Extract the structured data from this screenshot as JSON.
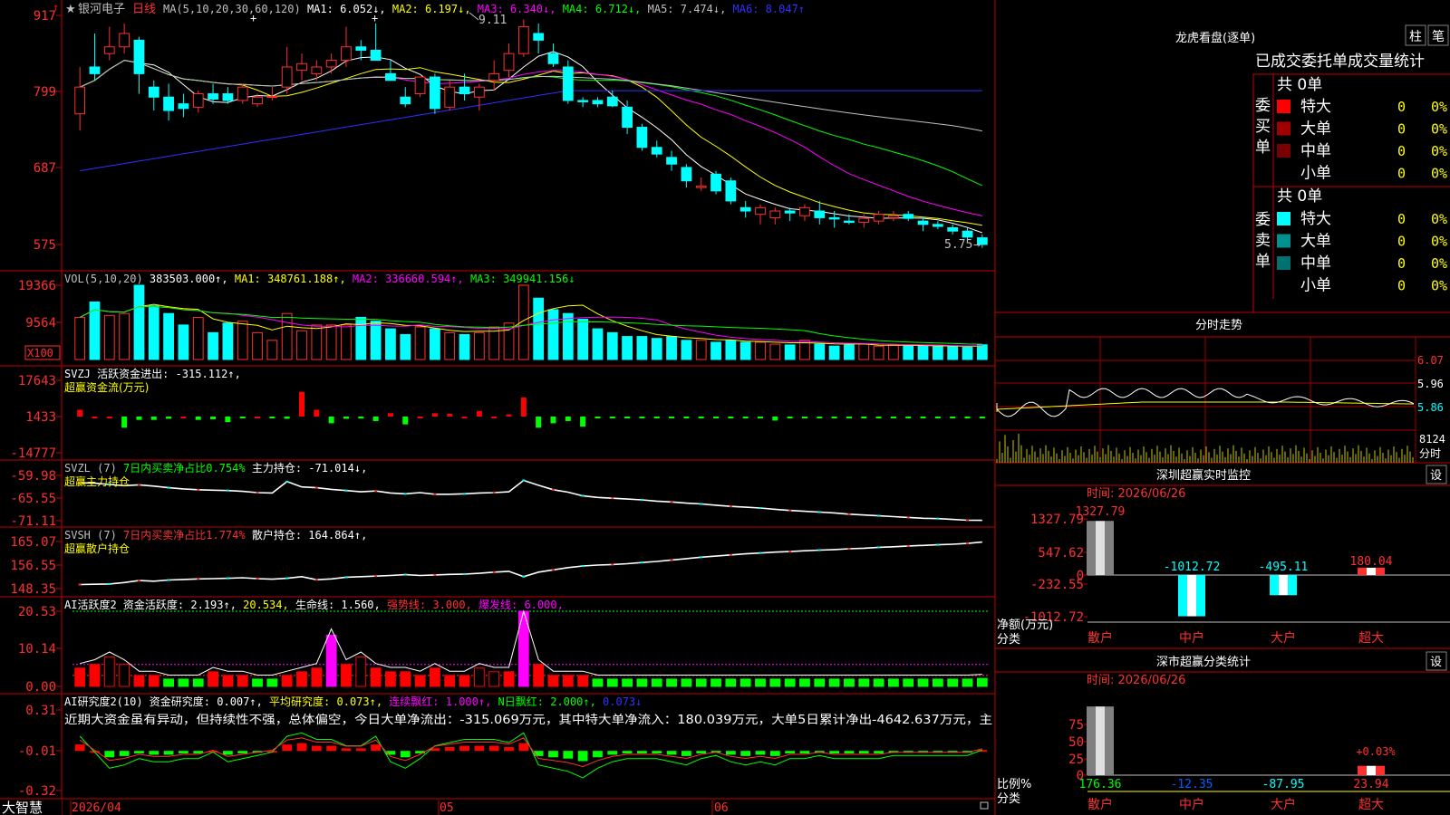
{
  "app": {
    "brand": "大智慧"
  },
  "stock": {
    "star": "★",
    "name": "银河电子",
    "period": "日线"
  },
  "kline": {
    "y_ticks": [
      "917",
      "799",
      "687",
      "575"
    ],
    "high_label": "9.11",
    "low_label": "5.75",
    "ma_legend": [
      {
        "text": "MA(5,10,20,30,60,120)",
        "color": "#c0c0c0"
      },
      {
        "text": "MA1: 6.052↓,",
        "color": "#ffffff"
      },
      {
        "text": "MA2: 6.197↓,",
        "color": "#ffff00"
      },
      {
        "text": "MA3: 6.340↓,",
        "color": "#ff00ff"
      },
      {
        "text": "MA4: 6.712↓,",
        "color": "#00ff00"
      },
      {
        "text": "MA5: 7.474↓,",
        "color": "#c0c0c0"
      },
      {
        "text": "MA6: 8.047↑",
        "color": "#3030ff"
      }
    ]
  },
  "vol": {
    "y_ticks": [
      "19366",
      "9564"
    ],
    "unit": "X100",
    "legend": [
      {
        "text": "VOL(5,10,20)",
        "color": "#c0c0c0"
      },
      {
        "text": "383503.000↑,",
        "color": "#ffffff"
      },
      {
        "text": "MA1: 348761.188↑,",
        "color": "#ffff00"
      },
      {
        "text": "MA2: 336660.594↑,",
        "color": "#ff00ff"
      },
      {
        "text": "MA3: 349941.156↓",
        "color": "#00ff00"
      }
    ]
  },
  "svzj": {
    "y_ticks": [
      "17643",
      "1433",
      "-14777"
    ],
    "legend": [
      {
        "text": "SVZJ  活跃资金进出: -315.112↑,",
        "color": "#ffffff"
      }
    ],
    "subtitle": "超赢资金流(万元)"
  },
  "svzl": {
    "y_ticks": [
      "-59.98",
      "-65.55",
      "-71.11"
    ],
    "legend": [
      {
        "text": "SVZL (7)",
        "color": "#c0c0c0"
      },
      {
        "text": "7日内买卖净占比0.754%",
        "color": "#00ff00"
      },
      {
        "text": "主力持仓: -71.014↓,",
        "color": "#ffffff"
      }
    ],
    "subtitle": "超赢主力持仓"
  },
  "svsh": {
    "y_ticks": [
      "165.07",
      "156.55",
      "148.35"
    ],
    "legend": [
      {
        "text": "SVSH (7)",
        "color": "#c0c0c0"
      },
      {
        "text": "7日内买卖净占比1.774%",
        "color": "#ff3030"
      },
      {
        "text": "散户持仓: 164.864↑,",
        "color": "#ffffff"
      }
    ],
    "subtitle": "超赢散户持仓"
  },
  "ai1": {
    "y_ticks": [
      "20.53",
      "10.14",
      "0.00"
    ],
    "legend": [
      {
        "text": "AI活跃度2 资金活跃度: 2.193↑,",
        "color": "#ffffff"
      },
      {
        "text": "20.534,",
        "color": "#ffff00"
      },
      {
        "text": "生命线: 1.560,",
        "color": "#ffffff"
      },
      {
        "text": "强势线: 3.000,",
        "color": "#ff3030"
      },
      {
        "text": "爆发线: 6.000,",
        "color": "#ff00ff"
      }
    ]
  },
  "ai2": {
    "y_ticks": [
      "0.31",
      "-0.01",
      "-0.32"
    ],
    "legend": [
      {
        "text": "AI研究度2(10) 资金研究度: 0.007↑,",
        "color": "#ffffff"
      },
      {
        "text": "平均研究度: 0.073↑,",
        "color": "#ffff00"
      },
      {
        "text": "连续飘红: 1.000↑,",
        "color": "#ff00ff"
      },
      {
        "text": "N日飘红: 2.000↑,",
        "color": "#00ff00"
      },
      {
        "text": "0.073↓",
        "color": "#3030ff"
      }
    ],
    "comment": "近期大资金虽有异动，但持续性不强，总体偏空，今日大单净流出：-315.069万元，其中特大单净流入：180.039万元，大单5日累计净出-4642.637万元，主"
  },
  "xaxis": {
    "labels": [
      "2026/04",
      "05",
      "06"
    ]
  },
  "dragon": {
    "title": "龙虎看盘(逐单)",
    "btn1": "柱",
    "btn2": "笔",
    "heading": "已成交委托单成交量统计",
    "buy": {
      "label": "委买单",
      "total": "共 0单",
      "rows": [
        {
          "name": "特大",
          "vol": "0",
          "pct": "0%",
          "color": "#ff0000"
        },
        {
          "name": "大单",
          "vol": "0",
          "pct": "0%",
          "color": "#a00000"
        },
        {
          "name": "中单",
          "vol": "0",
          "pct": "0%",
          "color": "#780000"
        },
        {
          "name": "小单",
          "vol": "0",
          "pct": "0%",
          "color": "#000000"
        }
      ]
    },
    "sell": {
      "label": "委卖单",
      "total": "共 0单",
      "rows": [
        {
          "name": "特大",
          "vol": "0",
          "pct": "0%",
          "color": "#00ffff"
        },
        {
          "name": "大单",
          "vol": "0",
          "pct": "0%",
          "color": "#009090"
        },
        {
          "name": "中单",
          "vol": "0",
          "pct": "0%",
          "color": "#007070"
        },
        {
          "name": "小单",
          "vol": "0",
          "pct": "0%",
          "color": "#000000"
        }
      ]
    }
  },
  "intraday": {
    "title": "分时走势",
    "y_ticks": [
      "6.07",
      "5.96",
      "5.86"
    ],
    "vol_tick": "8124",
    "unit_label": "分时"
  },
  "monitor": {
    "title": "深圳超赢实时监控",
    "settings": "设",
    "time": "时间: 2026/06/26",
    "y_ticks": [
      "1327.79",
      "547.62",
      "0",
      "-232.55",
      "-1012.72"
    ],
    "axis_title_1": "净额(万元)",
    "axis_title_2": "分类",
    "bars": [
      {
        "cat": "散户",
        "value": 1327.79,
        "label": "1327.79"
      },
      {
        "cat": "中户",
        "value": -1012.72,
        "label": "-1012.72"
      },
      {
        "cat": "大户",
        "value": -495.11,
        "label": "-495.11"
      },
      {
        "cat": "超大",
        "value": 180.04,
        "label": "180.04"
      }
    ]
  },
  "classstat": {
    "title": "深市超赢分类统计",
    "settings": "设",
    "time": "时间: 2026/06/26",
    "y_ticks": [
      "75",
      "50",
      "25",
      "0"
    ],
    "axis_title_1": "比例%",
    "axis_title_2": "分类",
    "top_label": "+0.03%",
    "bars": [
      {
        "cat": "散户",
        "value": 176.36,
        "label": "176.36"
      },
      {
        "cat": "中户",
        "value": -12.35,
        "label": "-12.35"
      },
      {
        "cat": "大户",
        "value": -87.95,
        "label": "-87.95"
      },
      {
        "cat": "超大",
        "value": 23.94,
        "label": "23.94"
      }
    ]
  },
  "chart_data": [
    {
      "type": "candlestick",
      "title": "银河电子 日线",
      "x": [
        "2026/04",
        "05",
        "06"
      ],
      "ohlc": [
        [
          7.7,
          8.4,
          7.45,
          8.1
        ],
        [
          8.4,
          8.9,
          8.2,
          8.3
        ],
        [
          8.6,
          9.0,
          8.5,
          8.7
        ],
        [
          8.7,
          9.05,
          8.6,
          8.9
        ],
        [
          8.8,
          8.85,
          8.0,
          8.3
        ],
        [
          8.1,
          8.2,
          7.75,
          7.95
        ],
        [
          7.95,
          8.15,
          7.6,
          7.75
        ],
        [
          7.85,
          8.0,
          7.65,
          7.78
        ],
        [
          7.8,
          8.05,
          7.72,
          8.0
        ],
        [
          8.0,
          8.15,
          7.85,
          7.92
        ],
        [
          8.0,
          8.1,
          7.85,
          7.9
        ],
        [
          7.9,
          8.15,
          7.85,
          8.1
        ],
        [
          7.85,
          8.0,
          7.8,
          7.95
        ],
        [
          7.95,
          8.1,
          7.9,
          7.96
        ],
        [
          8.1,
          8.7,
          8.0,
          8.4
        ],
        [
          8.35,
          8.6,
          8.2,
          8.45
        ],
        [
          8.3,
          8.5,
          8.2,
          8.4
        ],
        [
          8.4,
          8.6,
          8.3,
          8.5
        ],
        [
          8.5,
          9.0,
          8.4,
          8.7
        ],
        [
          8.7,
          8.8,
          8.5,
          8.65
        ],
        [
          8.65,
          9.05,
          8.55,
          8.5
        ],
        [
          8.3,
          8.5,
          8.2,
          8.2
        ],
        [
          7.95,
          8.1,
          7.8,
          7.85
        ],
        [
          8.0,
          8.15,
          7.95,
          8.25
        ],
        [
          8.25,
          8.3,
          7.7,
          7.78
        ],
        [
          7.8,
          8.2,
          7.75,
          8.1
        ],
        [
          8.1,
          8.3,
          7.9,
          8.0
        ],
        [
          7.95,
          8.15,
          7.75,
          8.1
        ],
        [
          8.2,
          8.5,
          8.05,
          8.3
        ],
        [
          8.35,
          8.75,
          8.25,
          8.6
        ],
        [
          8.6,
          9.11,
          8.55,
          9.0
        ],
        [
          8.9,
          9.05,
          8.6,
          8.8
        ],
        [
          8.6,
          8.75,
          8.4,
          8.45
        ],
        [
          8.4,
          8.5,
          7.85,
          7.9
        ],
        [
          7.9,
          7.95,
          7.8,
          7.88
        ],
        [
          7.9,
          7.95,
          7.8,
          7.85
        ],
        [
          7.95,
          8.05,
          7.8,
          7.82
        ],
        [
          7.8,
          7.9,
          7.4,
          7.5
        ],
        [
          7.5,
          7.55,
          7.15,
          7.2
        ],
        [
          7.2,
          7.3,
          7.05,
          7.1
        ],
        [
          7.05,
          7.15,
          6.85,
          6.95
        ],
        [
          6.9,
          6.95,
          6.6,
          6.7
        ],
        [
          6.6,
          6.75,
          6.55,
          6.62
        ],
        [
          6.8,
          6.85,
          6.5,
          6.55
        ],
        [
          6.7,
          6.75,
          6.35,
          6.4
        ],
        [
          6.3,
          6.4,
          6.15,
          6.25
        ],
        [
          6.2,
          6.35,
          6.05,
          6.3
        ],
        [
          6.15,
          6.3,
          6.05,
          6.25
        ],
        [
          6.25,
          6.3,
          6.1,
          6.22
        ],
        [
          6.18,
          6.35,
          6.1,
          6.3
        ],
        [
          6.25,
          6.4,
          6.05,
          6.15
        ],
        [
          6.15,
          6.25,
          6.0,
          6.13
        ],
        [
          6.1,
          6.2,
          6.05,
          6.08
        ],
        [
          6.08,
          6.2,
          6.0,
          6.14
        ],
        [
          6.1,
          6.25,
          6.05,
          6.2
        ],
        [
          6.15,
          6.25,
          6.1,
          6.18
        ],
        [
          6.2,
          6.25,
          6.1,
          6.14
        ],
        [
          6.1,
          6.15,
          5.95,
          6.05
        ],
        [
          6.05,
          6.1,
          5.98,
          6.02
        ],
        [
          6.0,
          6.05,
          5.9,
          5.95
        ],
        [
          5.95,
          6.0,
          5.83,
          5.86
        ],
        [
          5.85,
          5.9,
          5.7,
          5.75
        ]
      ],
      "ylim": [
        5.75,
        9.17
      ],
      "high": "9.11",
      "low": "5.75"
    },
    {
      "type": "bar",
      "title": "VOL(5,10,20)",
      "values": [
        11000,
        15000,
        11500,
        12000,
        19366,
        14000,
        12000,
        9000,
        11000,
        7000,
        9500,
        10000,
        7000,
        5000,
        12000,
        7500,
        9000,
        9000,
        9000,
        11000,
        10000,
        8000,
        6500,
        8500,
        8000,
        7000,
        6500,
        7000,
        8500,
        9500,
        19366,
        16000,
        13000,
        12000,
        10500,
        8000,
        7000,
        6000,
        6000,
        5500,
        6000,
        5000,
        5000,
        4500,
        5000,
        4500,
        4500,
        4000,
        3800,
        5000,
        4000,
        3500,
        3800,
        4000,
        3500,
        3800,
        3500,
        3500,
        3400,
        3500,
        3200,
        3835
      ],
      "unit": "X100"
    },
    {
      "type": "bar",
      "title": "SVZJ 活跃资金进出",
      "values": [
        3000,
        0,
        0,
        -5000,
        -1500,
        -1500,
        -1000,
        0,
        -1500,
        -1200,
        -2500,
        -800,
        0,
        -600,
        -1000,
        11000,
        3000,
        -3000,
        -1000,
        -900,
        -2000,
        1500,
        -3500,
        0,
        1500,
        1200,
        0,
        2500,
        0,
        1000,
        8500,
        -5000,
        -3000,
        -2000,
        -4500,
        -500,
        -500,
        -500,
        -300,
        -200,
        -400,
        -200,
        -300,
        -200,
        -300,
        -150,
        -200,
        -1800,
        -200,
        -100,
        -100,
        -100,
        -100,
        -100,
        -100,
        -100,
        -100,
        -100,
        -100,
        -100,
        -100,
        -315.112
      ],
      "ylim": [
        -14777,
        17643
      ]
    },
    {
      "type": "line",
      "title": "SVZL 主力持仓",
      "values": [
        -61.8,
        -61.9,
        -62.2,
        -62.5,
        -62.3,
        -62.6,
        -63.0,
        -63.3,
        -63.5,
        -63.6,
        -63.7,
        -63.9,
        -64.2,
        -64.3,
        -61.5,
        -62.8,
        -63.0,
        -63.4,
        -63.7,
        -64.0,
        -63.8,
        -64.3,
        -64.5,
        -64.2,
        -64.6,
        -64.6,
        -64.5,
        -64.3,
        -64.2,
        -64.0,
        -61.2,
        -62.4,
        -63.5,
        -64.1,
        -65.0,
        -65.4,
        -65.6,
        -65.8,
        -66.0,
        -66.3,
        -66.5,
        -66.8,
        -67.0,
        -67.3,
        -67.6,
        -67.8,
        -68.0,
        -68.3,
        -68.6,
        -68.8,
        -69.0,
        -69.2,
        -69.5,
        -69.7,
        -69.9,
        -70.1,
        -70.3,
        -70.5,
        -70.6,
        -70.8,
        -71.0,
        -71.014
      ],
      "ylim": [
        -71.11,
        -59.98
      ]
    },
    {
      "type": "line",
      "title": "SVSH 散户持仓",
      "values": [
        149.8,
        149.9,
        150.0,
        150.5,
        151.2,
        151.0,
        151.4,
        151.6,
        151.8,
        151.9,
        152.0,
        152.2,
        151.9,
        151.7,
        152.0,
        152.6,
        151.5,
        151.8,
        152.4,
        152.6,
        152.8,
        153.0,
        153.3,
        153.0,
        153.2,
        153.4,
        153.5,
        153.8,
        154.2,
        154.5,
        152.6,
        154.2,
        155.0,
        155.8,
        156.4,
        156.7,
        156.9,
        157.2,
        157.6,
        158.0,
        158.5,
        159.0,
        159.5,
        159.9,
        160.3,
        160.7,
        161.0,
        161.3,
        161.5,
        161.8,
        162.0,
        162.2,
        162.5,
        162.7,
        163.0,
        163.2,
        163.5,
        163.7,
        163.9,
        164.1,
        164.4,
        164.864
      ],
      "ylim": [
        148.35,
        165.07
      ]
    },
    {
      "type": "bar",
      "title": "AI活跃度2",
      "values": [
        5,
        6,
        8,
        6,
        3,
        3,
        2,
        2,
        2,
        4,
        3,
        3,
        2,
        2,
        3,
        4,
        5,
        14,
        6,
        8,
        5,
        4,
        4,
        3,
        5,
        3,
        3,
        5,
        4,
        4,
        20.534,
        6,
        3,
        3,
        3,
        2,
        2,
        2,
        2,
        2,
        2,
        2,
        2,
        2,
        2,
        2,
        2,
        2,
        2,
        2,
        2,
        2,
        2,
        2,
        2,
        2,
        2,
        2,
        2,
        2,
        2,
        2.193
      ],
      "ylim": [
        0,
        20.53
      ]
    },
    {
      "type": "bar",
      "title": "AI研究度2(10)",
      "values": [
        0.05,
        0,
        -0.05,
        -0.04,
        -0.02,
        -0.03,
        -0.03,
        -0.02,
        -0.02,
        0,
        -0.03,
        -0.02,
        -0.01,
        0,
        0.05,
        0.06,
        0.04,
        0.04,
        0.02,
        0.02,
        0.05,
        -0.03,
        -0.05,
        -0.02,
        0.02,
        0.03,
        0.04,
        0.04,
        0.04,
        0.03,
        0.06,
        -0.04,
        -0.05,
        -0.06,
        -0.08,
        -0.05,
        -0.03,
        -0.02,
        -0.02,
        -0.02,
        -0.03,
        -0.04,
        -0.02,
        -0.01,
        -0.03,
        -0.04,
        -0.03,
        -0.04,
        -0.02,
        -0.02,
        -0.01,
        -0.02,
        -0.02,
        -0.02,
        -0.02,
        -0.01,
        -0.01,
        -0.01,
        -0.01,
        -0.01,
        -0.01,
        0.007
      ],
      "ylim": [
        -0.32,
        0.31
      ]
    },
    {
      "type": "bar",
      "title": "深圳超赢实时监控",
      "categories": [
        "散户",
        "中户",
        "大户",
        "超大"
      ],
      "values": [
        1327.79,
        -1012.72,
        -495.11,
        180.04
      ],
      "ylabel": "净额(万元)",
      "xlabel": "分类",
      "ylim": [
        -1012.72,
        1327.79
      ]
    },
    {
      "type": "bar",
      "title": "深市超赢分类统计",
      "categories": [
        "散户",
        "中户",
        "大户",
        "超大"
      ],
      "values": [
        176.36,
        -12.35,
        -87.95,
        23.94
      ],
      "ylabel": "比例%",
      "xlabel": "分类",
      "ylim": [
        0,
        75
      ]
    }
  ]
}
